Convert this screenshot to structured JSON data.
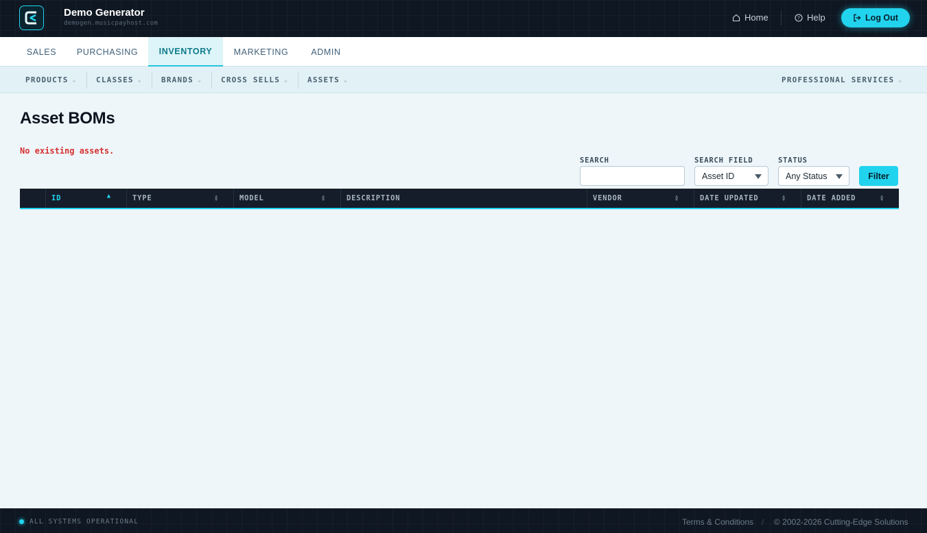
{
  "header": {
    "app_title": "Demo Generator",
    "app_subtitle": "demogen.musicpayhost.com",
    "home_label": "Home",
    "help_label": "Help",
    "logout_label": "Log Out"
  },
  "main_nav": {
    "tabs": [
      {
        "label": "SALES",
        "active": false
      },
      {
        "label": "PURCHASING",
        "active": false
      },
      {
        "label": "INVENTORY",
        "active": true
      },
      {
        "label": "MARKETING",
        "active": false
      },
      {
        "label": "ADMIN",
        "active": false
      }
    ]
  },
  "sub_nav": {
    "items": [
      {
        "label": "PRODUCTS"
      },
      {
        "label": "CLASSES"
      },
      {
        "label": "BRANDS"
      },
      {
        "label": "CROSS SELLS"
      },
      {
        "label": "ASSETS"
      }
    ],
    "right_item": {
      "label": "PROFESSIONAL SERVICES"
    }
  },
  "page": {
    "title": "Asset BOMs",
    "empty_message": "No existing assets."
  },
  "filters": {
    "search_label": "SEARCH",
    "search_value": "",
    "search_field_label": "SEARCH FIELD",
    "search_field_value": "Asset ID",
    "status_label": "STATUS",
    "status_value": "Any Status",
    "filter_button": "Filter"
  },
  "table": {
    "columns": [
      {
        "label": "ID",
        "sorted": "asc"
      },
      {
        "label": "TYPE",
        "sortable": true
      },
      {
        "label": "MODEL",
        "sortable": true
      },
      {
        "label": "DESCRIPTION",
        "sortable": false
      },
      {
        "label": "VENDOR",
        "sortable": true
      },
      {
        "label": "DATE UPDATED",
        "sortable": true
      },
      {
        "label": "DATE ADDED",
        "sortable": true
      }
    ],
    "rows": []
  },
  "footer": {
    "status_text": "ALL SYSTEMS OPERATIONAL",
    "terms_label": "Terms & Conditions",
    "separator": "/",
    "copyright": "© 2002-2026 Cutting-Edge Solutions"
  },
  "colors": {
    "accent": "#22d3ee",
    "header_bg": "#0f1722",
    "error": "#d63030",
    "page_bg": "#eef6f9"
  }
}
